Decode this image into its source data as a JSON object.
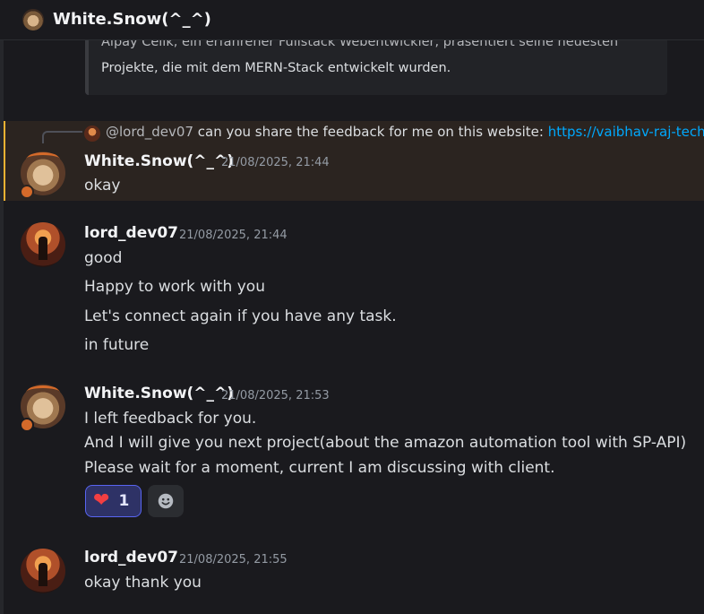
{
  "header": {
    "title": "White.Snow(^_^)"
  },
  "embed": {
    "faded_text": "Alpay Celik, ein erfahrener Fullstack Webentwickler, präsentiert seine neuesten",
    "text": "Projekte, die mit dem MERN-Stack entwickelt wurden."
  },
  "reply": {
    "mention": "@lord_dev07",
    "text": " can you share the feedback for me on this website: ",
    "link": "https://vaibhav-raj-tech."
  },
  "messages": [
    {
      "author": "White.Snow(^_^)",
      "timestamp": "21/08/2025, 21:44",
      "lines": [
        "okay"
      ]
    },
    {
      "author": "lord_dev07",
      "timestamp": "21/08/2025, 21:44",
      "lines": [
        "good",
        "Happy to work with you",
        "Let's connect again if you have any task.",
        "in future"
      ]
    },
    {
      "author": "White.Snow(^_^)",
      "timestamp": "21/08/2025, 21:53",
      "lines": [
        "I left feedback for you.",
        "And I will give you next project(about the amazon automation tool with SP-API)",
        "Please wait for a moment, current I am discussing with client."
      ]
    },
    {
      "author": "lord_dev07",
      "timestamp": "21/08/2025, 21:55",
      "lines": [
        "okay thank you"
      ]
    }
  ],
  "reaction": {
    "emoji": "heart",
    "count": "1",
    "color": "#f23f42"
  },
  "colors": {
    "accent": "#5865f2",
    "highlight_bar": "#f0b232",
    "link": "#00a8fc"
  }
}
